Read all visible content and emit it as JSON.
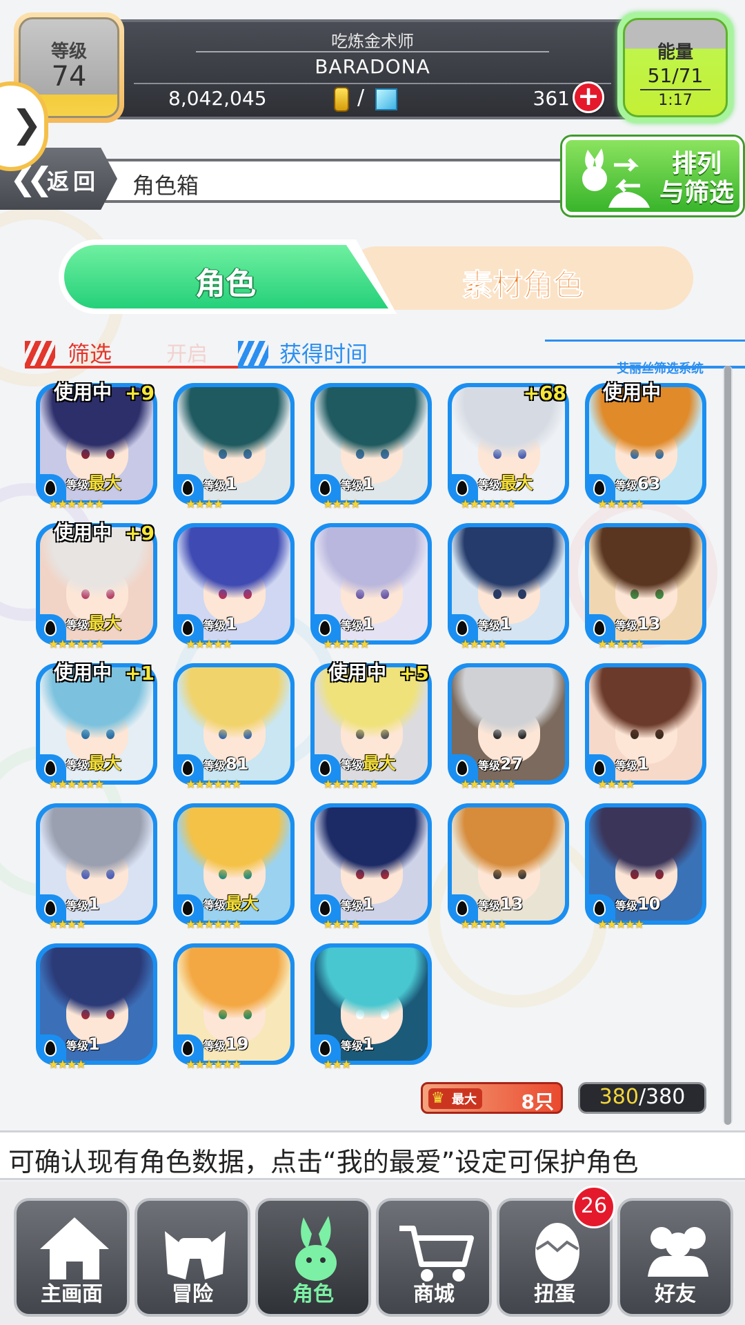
{
  "header": {
    "title": "吃炼金术师",
    "player_name": "BARADONA",
    "coins": "8,042,045",
    "gems": "361",
    "level_label": "等级",
    "level_value": "74",
    "energy_label": "能量",
    "energy_value": "51/71",
    "energy_timer": "1:17",
    "add_icon": "plus-icon",
    "coin_icon": "coin-icon",
    "gem_icon": "gem-icon"
  },
  "nav": {
    "back_label": "返回",
    "page_title": "角色箱",
    "sort_label_line1": "排列",
    "sort_label_line2": "与筛选"
  },
  "tabs": {
    "character": "角色",
    "material": "素材角色"
  },
  "filter": {
    "filter_label": "筛选",
    "filter_state": "开启",
    "sort_label": "获得时间",
    "system_label": "艾丽丝筛选系统"
  },
  "cards": [
    {
      "inuse": "使用中",
      "plus": "+9",
      "level_label": "等级",
      "level": "最大",
      "max": true,
      "stars": "★★★★★★",
      "colors": {
        "hair": "#2c2f6a",
        "bg": "#c8c9e6",
        "eye": "#8a2433"
      }
    },
    {
      "inuse": "",
      "plus": "",
      "level_label": "等级",
      "level": "1",
      "max": false,
      "stars": "★★★★",
      "colors": {
        "hair": "#1e5a60",
        "bg": "#dfe7ea",
        "eye": "#3e6e9e"
      }
    },
    {
      "inuse": "",
      "plus": "",
      "level_label": "等级",
      "level": "1",
      "max": false,
      "stars": "★★★★",
      "colors": {
        "hair": "#1e5a60",
        "bg": "#dfe7ea",
        "eye": "#3e6e9e"
      }
    },
    {
      "inuse": "",
      "plus": "+68",
      "level_label": "等级",
      "level": "最大",
      "max": true,
      "stars": "★★★★★★",
      "colors": {
        "hair": "#d6dbe3",
        "bg": "#eef1f5",
        "eye": "#4a5fb0"
      }
    },
    {
      "inuse": "使用中",
      "plus": "",
      "level_label": "等级",
      "level": "63",
      "max": false,
      "stars": "★★★★★",
      "colors": {
        "hair": "#e08a2a",
        "bg": "#bfe5f4",
        "eye": "#2f6ea8"
      }
    },
    {
      "inuse": "使用中",
      "plus": "+9",
      "level_label": "等级",
      "level": "最大",
      "max": true,
      "stars": "★★★★★★",
      "colors": {
        "hair": "#e7e4e2",
        "bg": "#f1d4c6",
        "eye": "#b6426a"
      }
    },
    {
      "inuse": "",
      "plus": "",
      "level_label": "等级",
      "level": "1",
      "max": false,
      "stars": "★★★★★",
      "colors": {
        "hair": "#3f4ab2",
        "bg": "#cfd7f2",
        "eye": "#b3325b"
      }
    },
    {
      "inuse": "",
      "plus": "",
      "level_label": "等级",
      "level": "1",
      "max": false,
      "stars": "★★★★★",
      "colors": {
        "hair": "#b9b7dd",
        "bg": "#e5e3f3",
        "eye": "#6a57a6"
      }
    },
    {
      "inuse": "",
      "plus": "",
      "level_label": "等级",
      "level": "1",
      "max": false,
      "stars": "★★★★★",
      "colors": {
        "hair": "#243b6b",
        "bg": "#d4e4f3",
        "eye": "#283a62"
      }
    },
    {
      "inuse": "",
      "plus": "",
      "level_label": "等级",
      "level": "13",
      "max": false,
      "stars": "★★★★★",
      "colors": {
        "hair": "#5a3621",
        "bg": "#f1d7b1",
        "eye": "#3e8b44"
      }
    },
    {
      "inuse": "使用中",
      "plus": "+1",
      "level_label": "等级",
      "level": "最大",
      "max": true,
      "stars": "★★★★★★",
      "colors": {
        "hair": "#7cc2de",
        "bg": "#e4eef4",
        "eye": "#2c6ea2"
      }
    },
    {
      "inuse": "",
      "plus": "",
      "level_label": "等级",
      "level": "81",
      "max": false,
      "stars": "★★★★★★",
      "colors": {
        "hair": "#f1d36b",
        "bg": "#c9e6f2",
        "eye": "#3a69a7"
      }
    },
    {
      "inuse": "使用中",
      "plus": "+5",
      "level_label": "等级",
      "level": "最大",
      "max": true,
      "stars": "★★★★★★",
      "colors": {
        "hair": "#efe27a",
        "bg": "#dcdce0",
        "eye": "#5a5a5a"
      }
    },
    {
      "inuse": "",
      "plus": "",
      "level_label": "等级",
      "level": "27",
      "max": false,
      "stars": "★★★★★★",
      "colors": {
        "hair": "#cfd1d4",
        "bg": "#7b6a5d",
        "eye": "#2a2a2a"
      }
    },
    {
      "inuse": "",
      "plus": "",
      "level_label": "等级",
      "level": "1",
      "max": false,
      "stars": "★★★★",
      "colors": {
        "hair": "#6b3a2a",
        "bg": "#f6d9c9",
        "eye": "#3a2a20"
      }
    },
    {
      "inuse": "",
      "plus": "",
      "level_label": "等级",
      "level": "1",
      "max": false,
      "stars": "★★★★",
      "colors": {
        "hair": "#9aa0b0",
        "bg": "#d9e2f3",
        "eye": "#4d5fb8"
      }
    },
    {
      "inuse": "",
      "plus": "",
      "level_label": "等级",
      "level": "最大",
      "max": true,
      "stars": "★★★★★★",
      "colors": {
        "hair": "#f4c246",
        "bg": "#9bd2ef",
        "eye": "#2c8b7a"
      }
    },
    {
      "inuse": "",
      "plus": "",
      "level_label": "等级",
      "level": "1",
      "max": false,
      "stars": "★★★★",
      "colors": {
        "hair": "#1c2a66",
        "bg": "#cfd3e8",
        "eye": "#a02c3a"
      }
    },
    {
      "inuse": "",
      "plus": "",
      "level_label": "等级",
      "level": "13",
      "max": false,
      "stars": "★★★★★",
      "colors": {
        "hair": "#d78c3c",
        "bg": "#e9e3d3",
        "eye": "#3b3b3b"
      }
    },
    {
      "inuse": "",
      "plus": "",
      "level_label": "等级",
      "level": "10",
      "max": false,
      "stars": "★★★★★",
      "colors": {
        "hair": "#3b355a",
        "bg": "#3a72b8",
        "eye": "#8a2431"
      }
    },
    {
      "inuse": "",
      "plus": "",
      "level_label": "等级",
      "level": "1",
      "max": false,
      "stars": "★★★★",
      "colors": {
        "hair": "#2b3b78",
        "bg": "#3b6fb8",
        "eye": "#a22a36"
      }
    },
    {
      "inuse": "",
      "plus": "",
      "level_label": "等级",
      "level": "19",
      "max": false,
      "stars": "★★★★★★",
      "colors": {
        "hair": "#f3a843",
        "bg": "#f8e7b8",
        "eye": "#2f8b5a"
      }
    },
    {
      "inuse": "",
      "plus": "",
      "level_label": "等级",
      "level": "1",
      "max": false,
      "stars": "★★★",
      "colors": {
        "hair": "#49c7d1",
        "bg": "#1c5a7a",
        "eye": "#ffffff"
      }
    }
  ],
  "counters": {
    "fav_badge": "最大",
    "fav_count": "8只",
    "box_current": "380",
    "box_sep": "/",
    "box_total": "380"
  },
  "hint": "可确认现有角色数据，点击“我的最爱”设定可保护角色",
  "bottom_nav": [
    {
      "label": "主画面",
      "icon": "home-icon"
    },
    {
      "label": "冒险",
      "icon": "handshake-icon"
    },
    {
      "label": "角色",
      "icon": "rabbit-icon"
    },
    {
      "label": "商城",
      "icon": "cart-icon"
    },
    {
      "label": "扭蛋",
      "icon": "egg-icon",
      "badge": "26"
    },
    {
      "label": "好友",
      "icon": "friends-icon"
    }
  ],
  "colors": {
    "accent_green": "#25d07a",
    "accent_orange": "#f07d20",
    "card_frame": "#1a8ff1",
    "filter_red": "#e3362c",
    "filter_blue": "#2b8ff0"
  }
}
